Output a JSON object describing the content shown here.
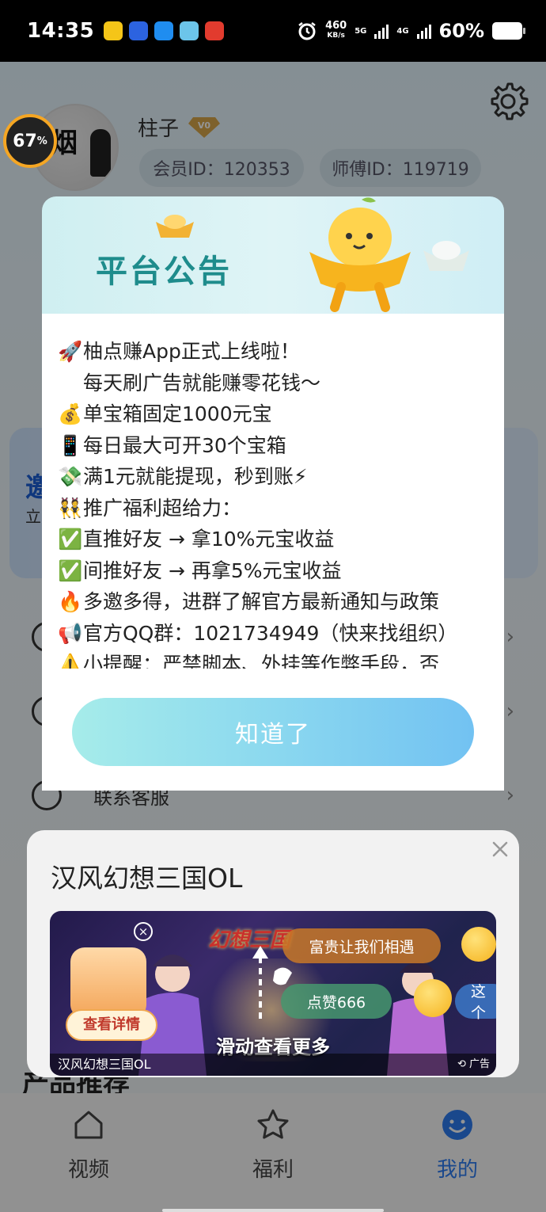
{
  "status_bar": {
    "time": "14:35",
    "net_speed_value": "460",
    "net_speed_unit": "KB/s",
    "net1": "5G",
    "net2": "4G",
    "battery": "60%"
  },
  "profile": {
    "username": "柱子",
    "vip_level": "V0",
    "member_id": "会员ID：120353",
    "master_id": "师傅ID：119719",
    "avatar_char": "烟"
  },
  "overlay_percent": "67",
  "overlay_percent_unit": "%",
  "background": {
    "invite_title": "邀",
    "invite_sub": "立",
    "contact_service": "联系客服",
    "section_title": "产品推荐"
  },
  "announcement": {
    "title": "平台公告",
    "lines": [
      {
        "icon": "🚀",
        "text": "柚点赚App正式上线啦！"
      },
      {
        "icon": "",
        "text": "每天刷广告就能赚零花钱～"
      },
      {
        "icon": "💰",
        "text": "单宝箱固定1000元宝"
      },
      {
        "icon": "📱",
        "text": "每日最大可开30个宝箱"
      },
      {
        "icon": "💸",
        "text": "满1元就能提现，秒到账⚡"
      },
      {
        "icon": "👯",
        "text": "推广福利超给力："
      },
      {
        "icon": "✅",
        "text": "直推好友 → 拿10%元宝收益"
      },
      {
        "icon": "✅",
        "text": "间推好友 → 再拿5%元宝收益"
      },
      {
        "icon": "🔥",
        "text": "多邀多得，进群了解官方最新通知与政策"
      },
      {
        "icon": "📢",
        "text": "官方QQ群：1021734949（快来找组织）"
      },
      {
        "icon": "⚠️",
        "text": "小提醒：严禁脚本、外挂等作弊手段，否"
      }
    ],
    "confirm_button": "知道了"
  },
  "ad": {
    "title": "汉风幻想三国OL",
    "bubble1": "富贵让我们相遇",
    "bubble2": "点赞666",
    "bubble3": "这个",
    "detail_button": "查看详情",
    "swipe_hint": "滑动查看更多",
    "footer_name": "汉风幻想三国OL",
    "ad_label": "广告",
    "logo_text": "幻想三国"
  },
  "tabbar": {
    "tabs": [
      {
        "label": "视频",
        "icon": "home-icon"
      },
      {
        "label": "福利",
        "icon": "star-icon"
      },
      {
        "label": "我的",
        "icon": "smile-icon"
      }
    ],
    "active": "我的"
  },
  "colors": {
    "accent": "#2d7cf2",
    "notice_title": "#1e8c8c",
    "button_gradient_start": "#a6ecea",
    "button_gradient_end": "#72c2f2"
  }
}
